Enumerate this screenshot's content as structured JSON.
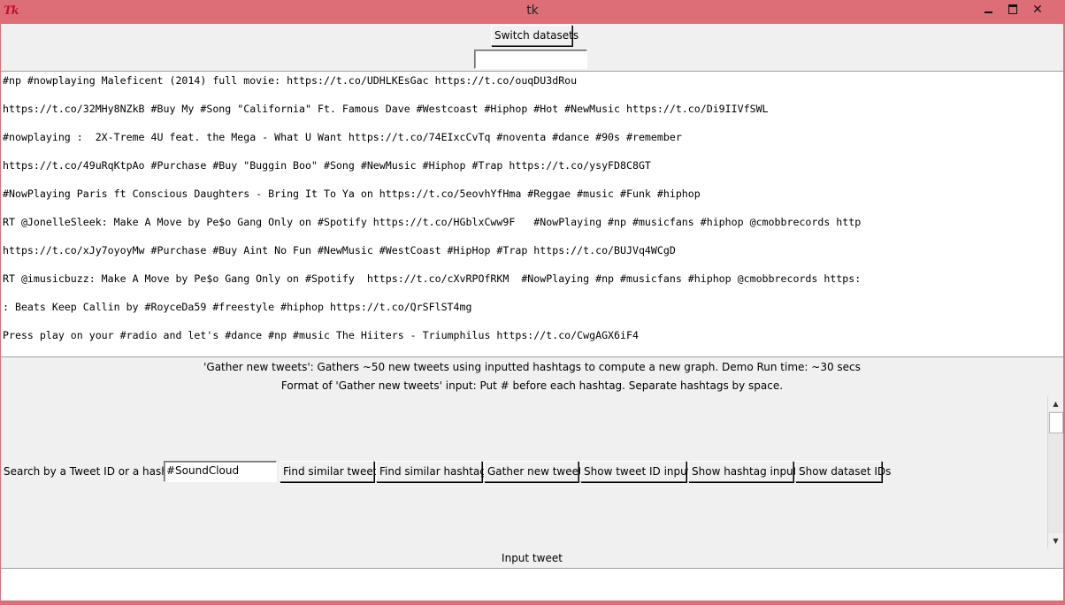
{
  "window": {
    "title": "tk",
    "icon_text": "Tk"
  },
  "top": {
    "switch_label": "Switch datasets",
    "small_entry_value": ""
  },
  "tweets": [
    "#np #nowplaying Maleficent (2014) full movie: https://t.co/UDHLKEsGac https://t.co/ouqDU3dRou",
    "https://t.co/32MHy8NZkB #Buy My #Song \"California\" Ft. Famous Dave #Westcoast #Hiphop #Hot #NewMusic https://t.co/Di9IIVfSWL",
    "#nowplaying :  2X-Treme 4U feat. the Mega - What U Want https://t.co/74EIxcCvTq #noventa #dance #90s #remember",
    "https://t.co/49uRqKtpAo #Purchase #Buy \"Buggin Boo\" #Song #NewMusic #Hiphop #Trap https://t.co/ysyFD8C8GT",
    "#NowPlaying Paris ft Conscious Daughters - Bring It To Ya on https://t.co/5eovhYfHma #Reggae #music #Funk #hiphop",
    "RT @JonelleSleek: Make A Move by Pe$o Gang Only on #Spotify https://t.co/HGblxCww9F   #NowPlaying #np #musicfans #hiphop @cmobbrecords http",
    "https://t.co/xJy7oyoyMw #Purchase #Buy Aint No Fun #NewMusic #WestCoast #HipHop #Trap https://t.co/BUJVq4WCgD",
    "RT @imusicbuzz: Make A Move by Pe$o Gang Only on #Spotify  https://t.co/cXvRPOfRKM  #NowPlaying #np #musicfans #hiphop @cmobbrecords https:",
    ": Beats Keep Callin by #RoyceDa59 #freestyle #hiphop https://t.co/QrSFlST4mg",
    "Press play on your #radio and let's #dance #np #music The Hiiters - Triumphilus https://t.co/CwgAGX6iF4"
  ],
  "info": {
    "line1": "'Gather new tweets': Gathers ~50 new tweets using inputted hashtags to compute a new graph. Demo Run time: ~30 secs",
    "line2": "Format of 'Gather new tweets' input: Put # before each hashtag. Separate hashtags by space."
  },
  "search": {
    "label": "Search by a Tweet ID or a hashtag",
    "value": "#SoundCloud",
    "buttons": {
      "find_tweets": "Find similar tweets",
      "find_hashtags": "Find similar hashtags",
      "gather": "Gather new tweets",
      "show_tweet_ids": "Show tweet ID inputs",
      "show_hashtag_inputs": "Show hashtag inputs",
      "show_dataset_ids": "Show dataset IDs"
    }
  },
  "bottom": {
    "input_tweet_label": "Input tweet",
    "input_tweet_value": ""
  },
  "colors": {
    "titlebar": "#dd6e78",
    "client": "#f0f0f0",
    "tk_icon": "#c8102e"
  },
  "icons": [
    "tk-app-icon",
    "minimize-icon",
    "maximize-icon",
    "close-icon",
    "scroll-up-arrow-icon",
    "scroll-down-arrow-icon"
  ]
}
